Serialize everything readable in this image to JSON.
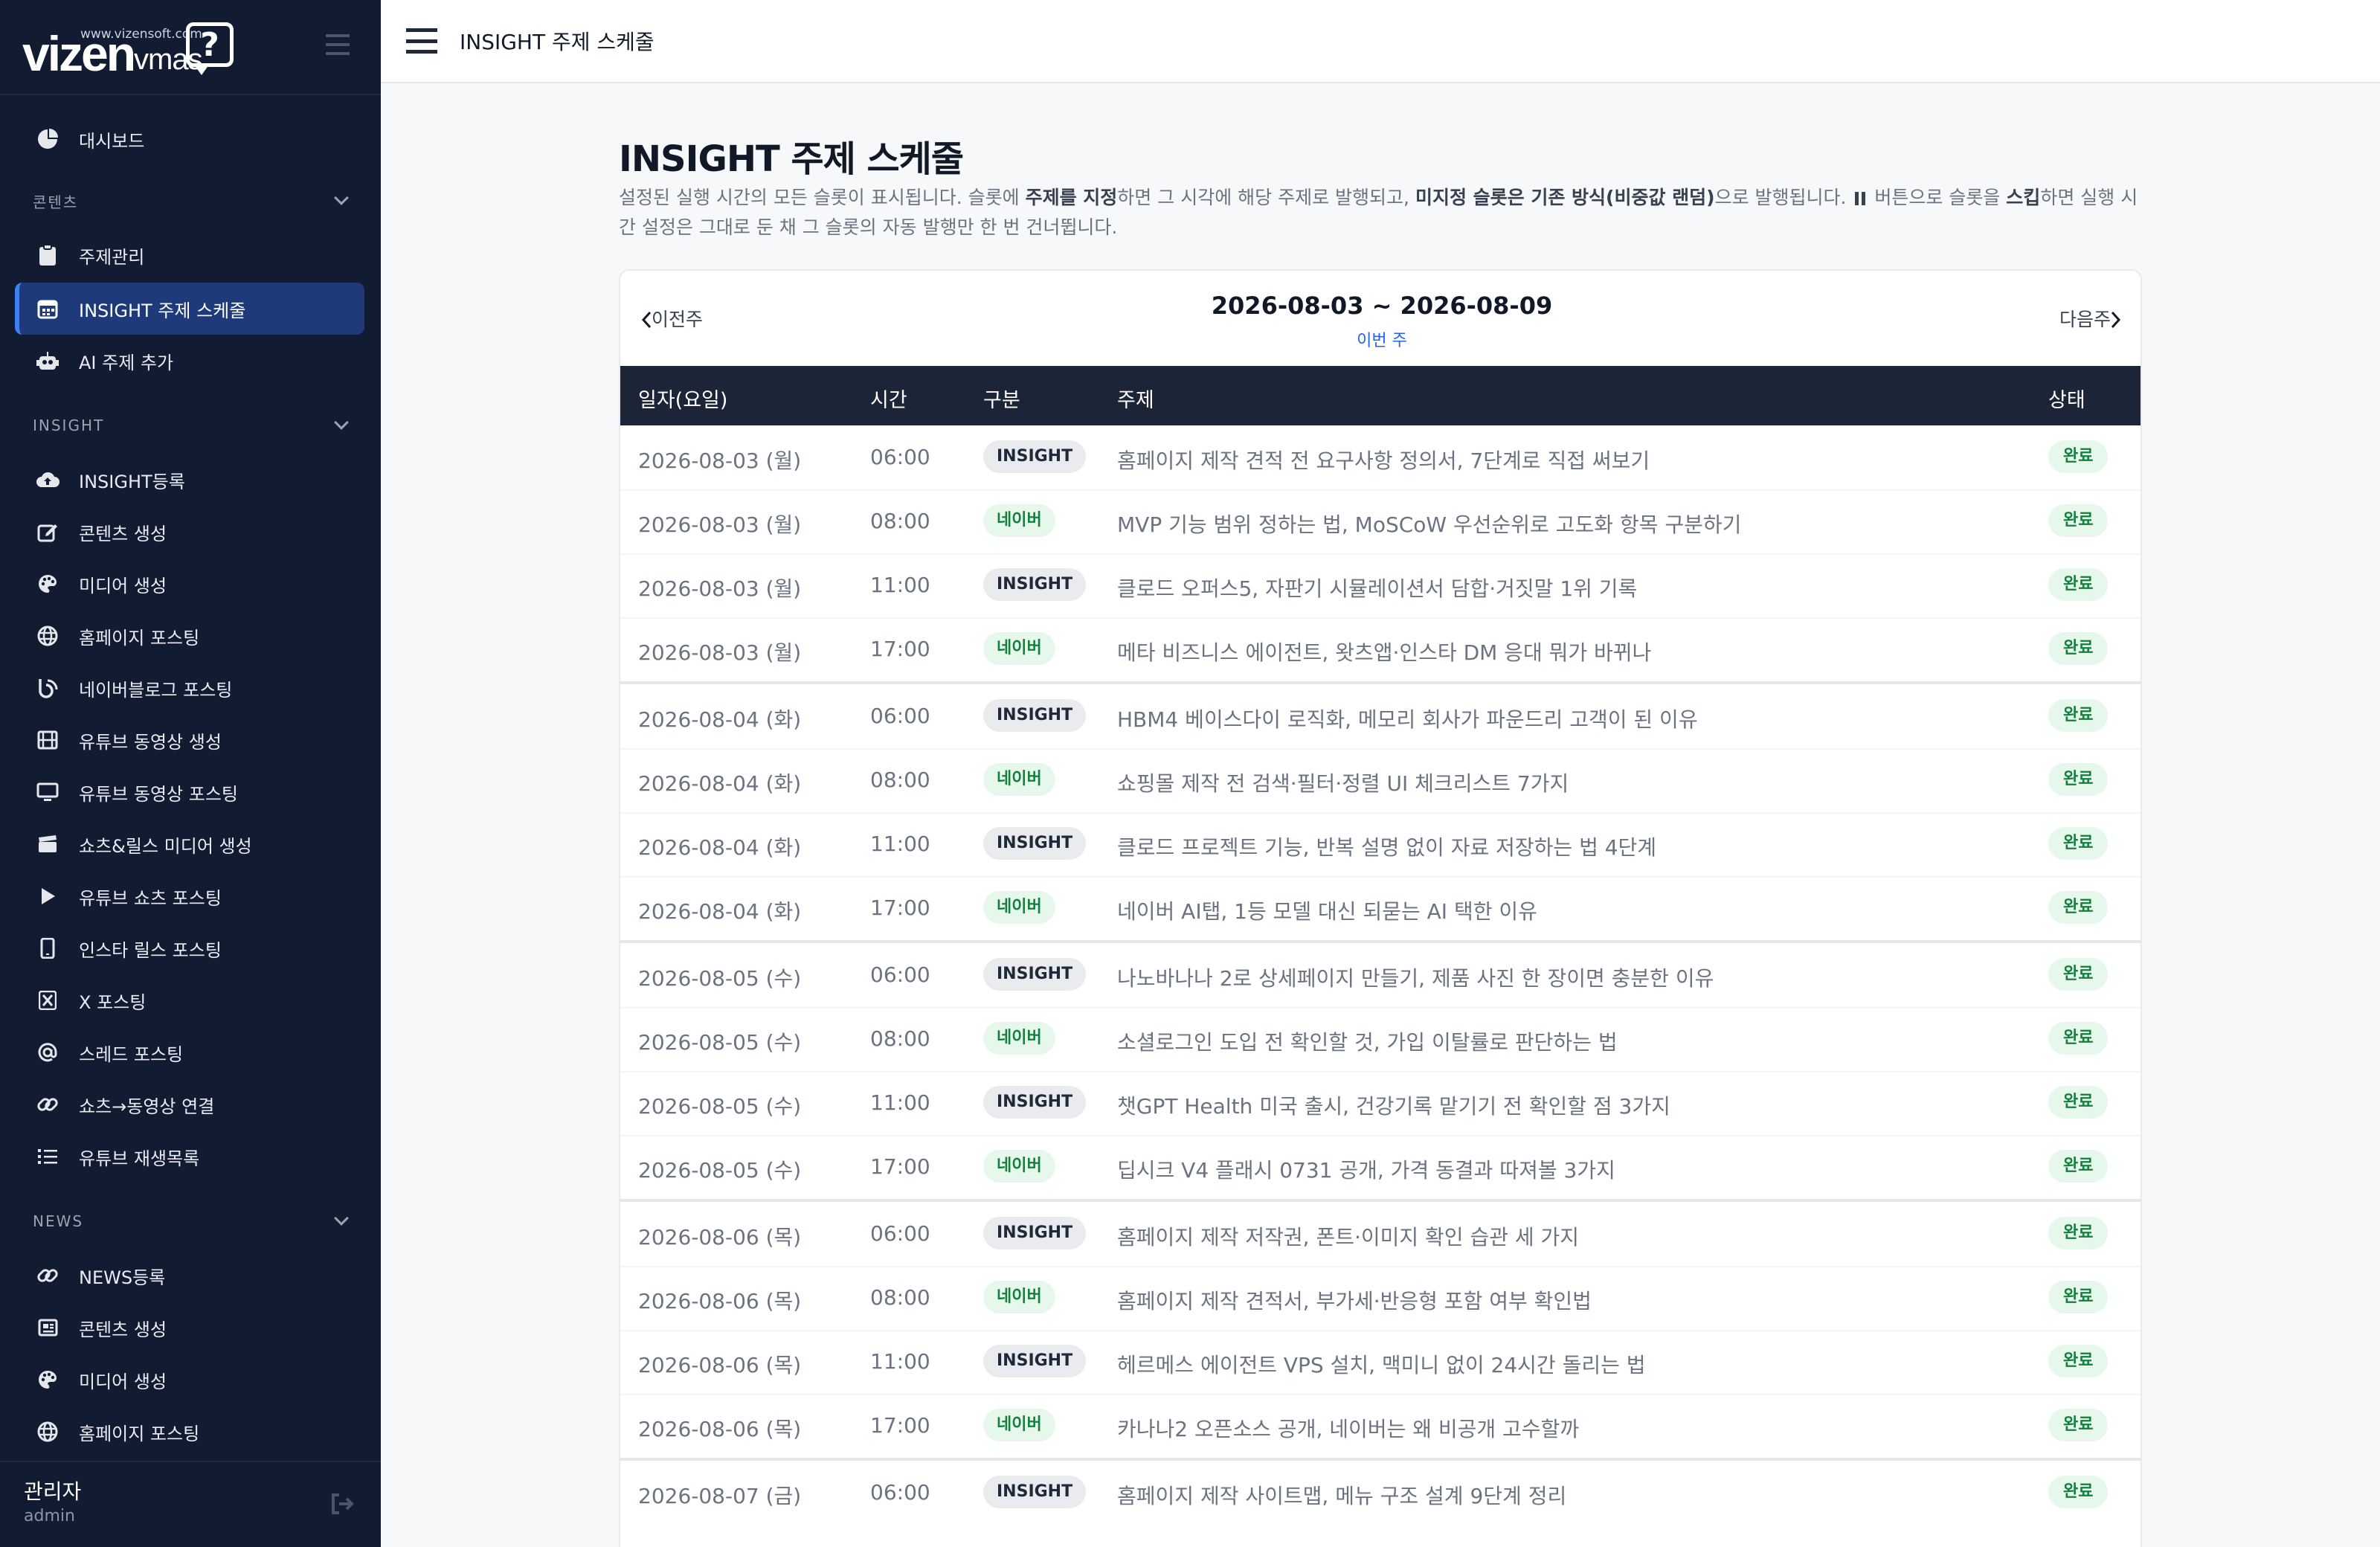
{
  "brand": {
    "site": "www.vizensoft.com",
    "logo_main": "vizen",
    "logo_sub": "vmas",
    "logo_q": "?"
  },
  "nav": {
    "dashboard": "대시보드",
    "sections": {
      "content": "콘텐츠",
      "insight": "INSIGHT",
      "news": "NEWS"
    },
    "content_items": [
      "주제관리",
      "INSIGHT 주제 스케줄",
      "AI 주제 추가"
    ],
    "insight_items": [
      "INSIGHT등록",
      "콘텐츠 생성",
      "미디어 생성",
      "홈페이지 포스팅",
      "네이버블로그 포스팅",
      "유튜브 동영상 생성",
      "유튜브 동영상 포스팅",
      "쇼츠&릴스 미디어 생성",
      "유튜브 쇼츠 포스팅",
      "인스타 릴스 포스팅",
      "X 포스팅",
      "스레드 포스팅",
      "쇼츠→동영상 연결",
      "유튜브 재생목록"
    ],
    "news_items": [
      "NEWS등록",
      "콘텐츠 생성",
      "미디어 생성",
      "홈페이지 포스팅"
    ]
  },
  "user": {
    "name": "관리자",
    "role": "admin"
  },
  "topbar": {
    "title": "INSIGHT 주제 스케줄"
  },
  "page": {
    "title": "INSIGHT 주제 스케줄",
    "desc": {
      "p1": "설정된 실행 시간의 모든 슬롯이 표시됩니다. 슬롯에 ",
      "b1": "주제를 지정",
      "p2": "하면 그 시각에 해당 주제로 발행되고, ",
      "b2": "미지정 슬롯은 기존 방식(비중값 랜덤)",
      "p3": "으로 발행됩니다. ",
      "p4": " 버튼으로 슬롯을 ",
      "b3": "스킵",
      "p5": "하면 실행 시간 설정은 그대로 둔 채 그 슬롯의 자동 발행만 한 번 건너뜁니다."
    }
  },
  "week": {
    "prev": "이전주",
    "next": "다음주",
    "range": "2026-08-03 ~ 2026-08-09",
    "this_week": "이번 주"
  },
  "table": {
    "headers": {
      "date": "일자(요일)",
      "time": "시간",
      "type": "구분",
      "topic": "주제",
      "status": "상태"
    },
    "rows": [
      {
        "date": "2026-08-03 (월)",
        "time": "06:00",
        "type": "INSIGHT",
        "topic": "홈페이지 제작 견적 전 요구사항 정의서, 7단계로 직접 써보기",
        "status": "완료"
      },
      {
        "date": "2026-08-03 (월)",
        "time": "08:00",
        "type": "네이버",
        "topic": "MVP 기능 범위 정하는 법, MoSCoW 우선순위로 고도화 항목 구분하기",
        "status": "완료"
      },
      {
        "date": "2026-08-03 (월)",
        "time": "11:00",
        "type": "INSIGHT",
        "topic": "클로드 오퍼스5, 자판기 시뮬레이션서 담합·거짓말 1위 기록",
        "status": "완료"
      },
      {
        "date": "2026-08-03 (월)",
        "time": "17:00",
        "type": "네이버",
        "topic": "메타 비즈니스 에이전트, 왓츠앱·인스타 DM 응대 뭐가 바뀌나",
        "status": "완료"
      },
      {
        "date": "2026-08-04 (화)",
        "time": "06:00",
        "type": "INSIGHT",
        "topic": "HBM4 베이스다이 로직화, 메모리 회사가 파운드리 고객이 된 이유",
        "status": "완료"
      },
      {
        "date": "2026-08-04 (화)",
        "time": "08:00",
        "type": "네이버",
        "topic": "쇼핑몰 제작 전 검색·필터·정렬 UI 체크리스트 7가지",
        "status": "완료"
      },
      {
        "date": "2026-08-04 (화)",
        "time": "11:00",
        "type": "INSIGHT",
        "topic": "클로드 프로젝트 기능, 반복 설명 없이 자료 저장하는 법 4단계",
        "status": "완료"
      },
      {
        "date": "2026-08-04 (화)",
        "time": "17:00",
        "type": "네이버",
        "topic": "네이버 AI탭, 1등 모델 대신 되묻는 AI 택한 이유",
        "status": "완료"
      },
      {
        "date": "2026-08-05 (수)",
        "time": "06:00",
        "type": "INSIGHT",
        "topic": "나노바나나 2로 상세페이지 만들기, 제품 사진 한 장이면 충분한 이유",
        "status": "완료"
      },
      {
        "date": "2026-08-05 (수)",
        "time": "08:00",
        "type": "네이버",
        "topic": "소셜로그인 도입 전 확인할 것, 가입 이탈률로 판단하는 법",
        "status": "완료"
      },
      {
        "date": "2026-08-05 (수)",
        "time": "11:00",
        "type": "INSIGHT",
        "topic": "챗GPT Health 미국 출시, 건강기록 맡기기 전 확인할 점 3가지",
        "status": "완료"
      },
      {
        "date": "2026-08-05 (수)",
        "time": "17:00",
        "type": "네이버",
        "topic": "딥시크 V4 플래시 0731 공개, 가격 동결과 따져볼 3가지",
        "status": "완료"
      },
      {
        "date": "2026-08-06 (목)",
        "time": "06:00",
        "type": "INSIGHT",
        "topic": "홈페이지 제작 저작권, 폰트·이미지 확인 습관 세 가지",
        "status": "완료"
      },
      {
        "date": "2026-08-06 (목)",
        "time": "08:00",
        "type": "네이버",
        "topic": "홈페이지 제작 견적서, 부가세·반응형 포함 여부 확인법",
        "status": "완료"
      },
      {
        "date": "2026-08-06 (목)",
        "time": "11:00",
        "type": "INSIGHT",
        "topic": "헤르메스 에이전트 VPS 설치, 맥미니 없이 24시간 돌리는 법",
        "status": "완료"
      },
      {
        "date": "2026-08-06 (목)",
        "time": "17:00",
        "type": "네이버",
        "topic": "카나나2 오픈소스 공개, 네이버는 왜 비공개 고수할까",
        "status": "완료"
      },
      {
        "date": "2026-08-07 (금)",
        "time": "06:00",
        "type": "INSIGHT",
        "topic": "홈페이지 제작 사이트맵, 메뉴 구조 설계 9단계 정리",
        "status": "완료"
      }
    ]
  },
  "colors": {
    "sidebar_bg": "#111b31",
    "active_bg": "#1e3a7a",
    "accent": "#3b82f6",
    "header_bg": "#1b2537",
    "done_green": "#15803d"
  }
}
